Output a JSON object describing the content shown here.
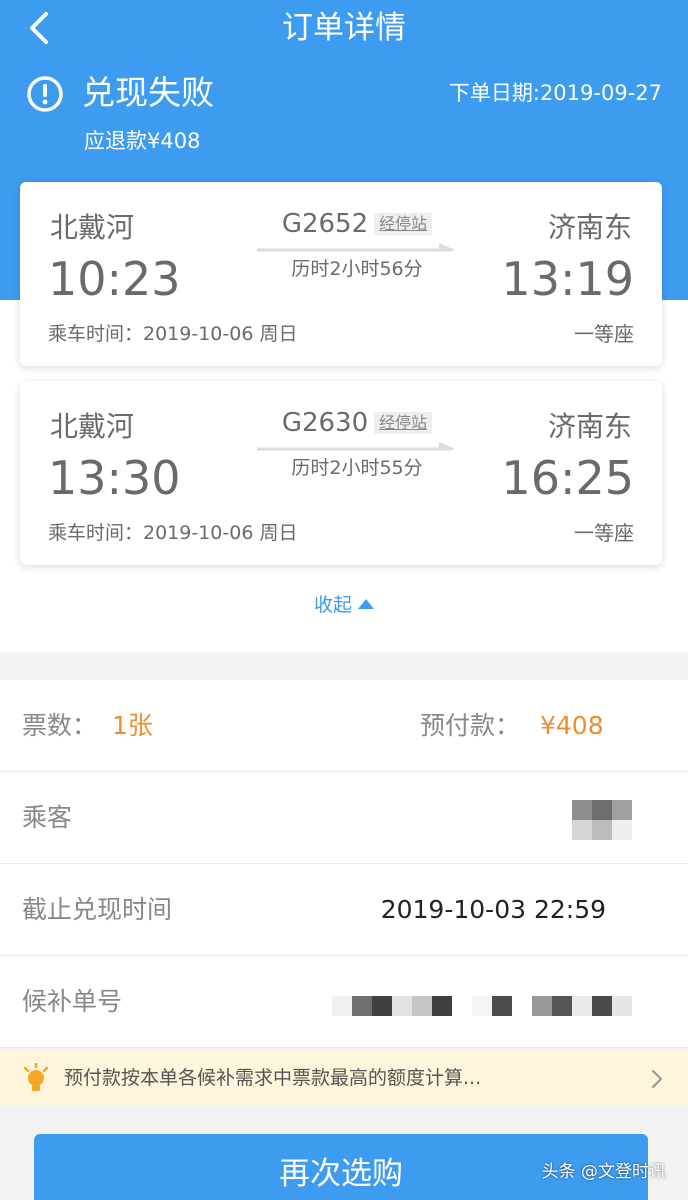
{
  "header": {
    "title": "订单详情",
    "status": "兑现失败",
    "order_date": "下单日期:2019-09-27",
    "refund": "应退款¥408"
  },
  "trips": [
    {
      "from": "北戴河",
      "to": "济南东",
      "depart_time": "10:23",
      "arrive_time": "13:19",
      "train_no": "G2652",
      "via_label": "经停站",
      "duration": "历时2小时56分",
      "ride_date": "乘车时间：2019-10-06 周日",
      "seat": "一等座"
    },
    {
      "from": "北戴河",
      "to": "济南东",
      "depart_time": "13:30",
      "arrive_time": "16:25",
      "train_no": "G2630",
      "via_label": "经停站",
      "duration": "历时2小时55分",
      "ride_date": "乘车时间：2019-10-06 周日",
      "seat": "一等座"
    }
  ],
  "collapse_label": "收起",
  "info": {
    "tickets_label": "票数：",
    "tickets_value": "1张",
    "prepay_label": "预付款：",
    "prepay_value": "¥408",
    "passenger_label": "乘客",
    "deadline_label": "截止兑现时间",
    "deadline_value": "2019-10-03 22:59",
    "order_no_label": "候补单号"
  },
  "notice": {
    "text": "预付款按本单各候补需求中票款最高的额度计算...",
    "icon": "lightbulb-icon"
  },
  "buy_button": "再次选购",
  "watermark": "头条 @文登时讯",
  "colors": {
    "primary": "#3d9bf0",
    "accent_orange": "#f08c2e",
    "notice_bg": "#fdf5dc"
  }
}
